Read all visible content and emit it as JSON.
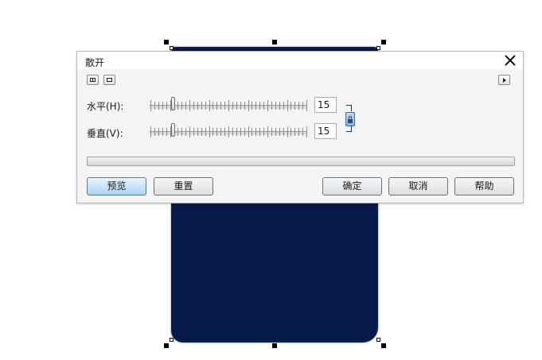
{
  "dialog": {
    "title": "散开",
    "horizontal": {
      "label": "水平(H):",
      "value": "15",
      "slider_fraction": 0.14
    },
    "vertical": {
      "label": "垂直(V):",
      "value": "15",
      "slider_fraction": 0.14
    },
    "progress": 0,
    "buttons": {
      "preview": "预览",
      "reset": "重置",
      "ok": "确定",
      "cancel": "取消",
      "help": "帮助"
    }
  },
  "colors": {
    "shape_fill": "#061a49",
    "accent": "#3c7fb1"
  }
}
